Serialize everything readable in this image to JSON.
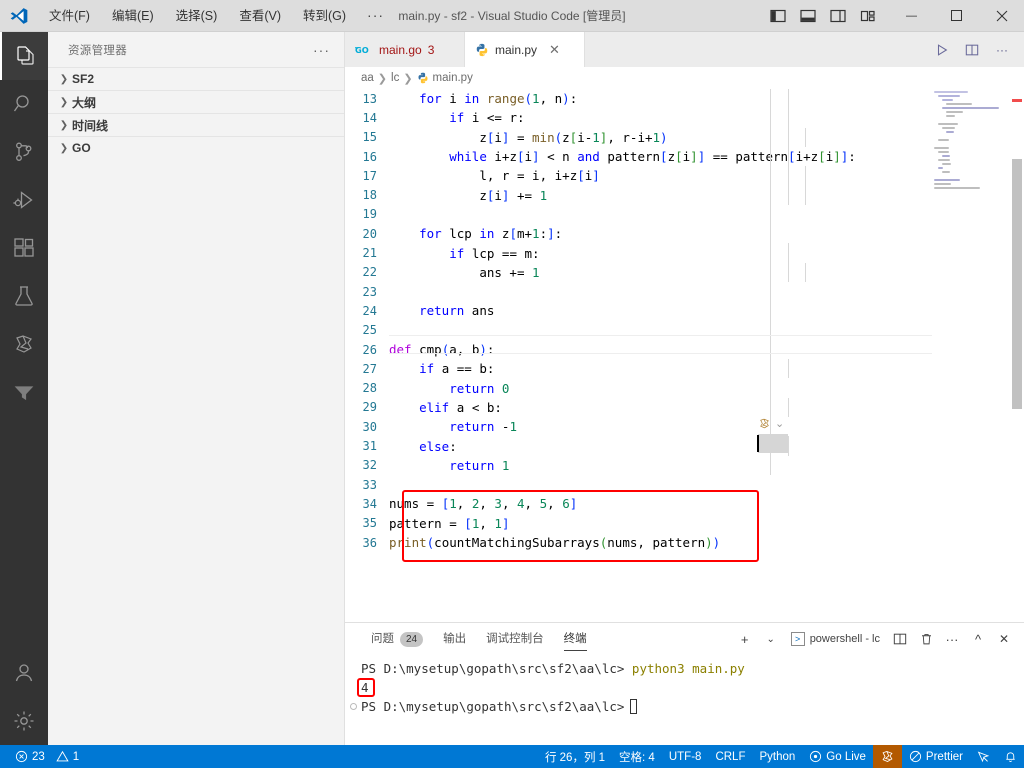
{
  "titlebar": {
    "title": "main.py - sf2 - Visual Studio Code [管理员]",
    "menu": [
      "文件(F)",
      "编辑(E)",
      "选择(S)",
      "查看(V)",
      "转到(G)"
    ],
    "menu_more": "···",
    "layout_buttons": [
      "toggle-primary-sidebar",
      "toggle-panel",
      "toggle-secondary-sidebar",
      "customize-layout"
    ],
    "window_buttons": {
      "minimize": "—",
      "maximize": "▢",
      "close": "✕"
    }
  },
  "activitybar": {
    "items": [
      {
        "name": "explorer",
        "active": true
      },
      {
        "name": "search",
        "active": false
      },
      {
        "name": "source-control",
        "active": false
      },
      {
        "name": "run-and-debug",
        "active": false
      },
      {
        "name": "extensions",
        "active": false
      },
      {
        "name": "testing",
        "active": false
      },
      {
        "name": "code-runner",
        "active": false
      },
      {
        "name": "filter",
        "active": false
      }
    ],
    "bottom": [
      {
        "name": "accounts"
      },
      {
        "name": "manage-settings"
      }
    ]
  },
  "sidebar": {
    "header": "资源管理器",
    "more": "···",
    "sections": [
      {
        "label": "SF2",
        "expanded": false
      },
      {
        "label": "大纲",
        "expanded": false
      },
      {
        "label": "时间线",
        "expanded": false
      },
      {
        "label": "GO",
        "expanded": false
      }
    ]
  },
  "tabs": [
    {
      "label": "main.go",
      "badge": "3",
      "icon": "go-icon",
      "active": false,
      "dirty": true
    },
    {
      "label": "main.py",
      "badge": "",
      "icon": "python-icon",
      "active": true,
      "dirty": false,
      "close": "✕"
    }
  ],
  "editor_actions": [
    "run-python-file",
    "split-editor-right",
    "more-actions"
  ],
  "breadcrumb": [
    "aa",
    "lc",
    "main.py"
  ],
  "codelens": {
    "label": "",
    "chevron": "⌄"
  },
  "code": {
    "first_line_number": 13,
    "lines": [
      {
        "n": 13,
        "text": "    for i in range(1, n):"
      },
      {
        "n": 14,
        "text": "        if i <= r:"
      },
      {
        "n": 15,
        "text": "            z[i] = min(z[i-1], r-i+1)"
      },
      {
        "n": 16,
        "text": "        while i+z[i] < n and pattern[z[i]] == pattern[i+z[i]]:"
      },
      {
        "n": 17,
        "text": "            l, r = i, i+z[i]"
      },
      {
        "n": 18,
        "text": "            z[i] += 1"
      },
      {
        "n": 19,
        "text": ""
      },
      {
        "n": 20,
        "text": "    for lcp in z[m+1:]:"
      },
      {
        "n": 21,
        "text": "        if lcp == m:"
      },
      {
        "n": 22,
        "text": "            ans += 1"
      },
      {
        "n": 23,
        "text": ""
      },
      {
        "n": 24,
        "text": "    return ans"
      },
      {
        "n": 25,
        "text": ""
      },
      {
        "n": 26,
        "text": "def cmp(a, b):"
      },
      {
        "n": 27,
        "text": "    if a == b:"
      },
      {
        "n": 28,
        "text": "        return 0"
      },
      {
        "n": 29,
        "text": "    elif a < b:"
      },
      {
        "n": 30,
        "text": "        return -1"
      },
      {
        "n": 31,
        "text": "    else:"
      },
      {
        "n": 32,
        "text": "        return 1"
      },
      {
        "n": 33,
        "text": ""
      },
      {
        "n": 34,
        "text": "nums = [1, 2, 3, 4, 5, 6]"
      },
      {
        "n": 35,
        "text": "pattern = [1, 1]"
      },
      {
        "n": 36,
        "text": "print(countMatchingSubarrays(nums, pattern))"
      }
    ]
  },
  "panel": {
    "tabs": [
      {
        "label": "问题",
        "count": "24",
        "active": false
      },
      {
        "label": "输出",
        "count": "",
        "active": false
      },
      {
        "label": "调试控制台",
        "count": "",
        "active": false
      },
      {
        "label": "终端",
        "count": "",
        "active": true
      }
    ],
    "actions": {
      "new_terminal": "+",
      "new_terminal_dropdown": "⌄",
      "terminal_name": "powershell - lc",
      "split": "split-terminal",
      "kill": "trash-icon",
      "more": "···",
      "maximize": "^",
      "close": "✕"
    }
  },
  "terminal": {
    "lines": [
      {
        "type": "command",
        "prompt": "PS D:\\mysetup\\gopath\\src\\sf2\\aa\\lc>",
        "cmd": " python3 main.py"
      },
      {
        "type": "output",
        "text": "4"
      },
      {
        "type": "prompt",
        "prompt": "PS D:\\mysetup\\gopath\\src\\sf2\\aa\\lc>",
        "cmd": ""
      }
    ]
  },
  "statusbar": {
    "left": [
      {
        "name": "errors",
        "icon": "error-icon",
        "text": "23"
      },
      {
        "name": "warnings",
        "icon": "warning-icon",
        "text": "1"
      }
    ],
    "right": [
      {
        "name": "cursor-position",
        "text": "行 26，列 1"
      },
      {
        "name": "indentation",
        "text": "空格: 4"
      },
      {
        "name": "encoding",
        "text": "UTF-8"
      },
      {
        "name": "eol",
        "text": "CRLF"
      },
      {
        "name": "language-mode",
        "text": "Python"
      },
      {
        "name": "go-live",
        "text": "Go Live",
        "icon": "broadcast-icon"
      },
      {
        "name": "code-runner",
        "text": "",
        "icon": "code-runner-icon",
        "highlight": "#b35900"
      },
      {
        "name": "prettier",
        "text": "Prettier",
        "icon": "prettier-icon"
      },
      {
        "name": "feedback",
        "text": "",
        "icon": "feedback-icon"
      },
      {
        "name": "notifications",
        "text": "",
        "icon": "bell-icon"
      }
    ]
  },
  "colors": {
    "accent": "#0078d4",
    "titlebar_bg": "#dddddd",
    "activitybar_bg": "#333333",
    "sidebar_bg": "#f3f3f3",
    "editor_bg": "#ffffff",
    "highlight_box": "#ff0000"
  }
}
